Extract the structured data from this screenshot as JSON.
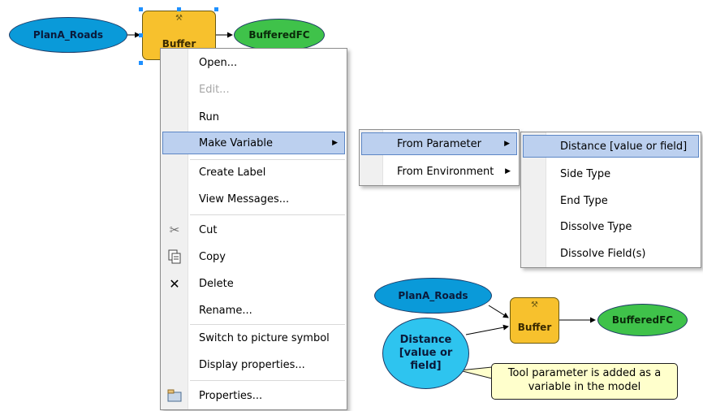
{
  "top_model": {
    "input_label": "PlanA_Roads",
    "tool_label": "Buffer",
    "output_label": "BufferedFC"
  },
  "context_menu": {
    "items": [
      {
        "label": "Open..."
      },
      {
        "label": "Edit..."
      },
      {
        "label": "Run"
      },
      {
        "label": "Make Variable"
      },
      {
        "label": "Create Label"
      },
      {
        "label": "View Messages..."
      },
      {
        "label": "Cut"
      },
      {
        "label": "Copy"
      },
      {
        "label": "Delete"
      },
      {
        "label": "Rename..."
      },
      {
        "label": "Switch to picture symbol"
      },
      {
        "label": "Display properties..."
      },
      {
        "label": "Properties..."
      }
    ]
  },
  "submenu_variable": {
    "items": [
      {
        "label": "From Parameter"
      },
      {
        "label": "From Environment"
      }
    ]
  },
  "submenu_parameter": {
    "items": [
      {
        "label": "Distance [value or field]"
      },
      {
        "label": "Side Type"
      },
      {
        "label": "End Type"
      },
      {
        "label": "Dissolve Type"
      },
      {
        "label": "Dissolve Field(s)"
      }
    ]
  },
  "bottom_model": {
    "input_label": "PlanA_Roads",
    "tool_label": "Buffer",
    "output_label": "BufferedFC",
    "variable_label": "Distance [value or field]"
  },
  "callout": {
    "text": "Tool parameter is added as a variable in the model"
  },
  "colors": {
    "input_fill": "#0a9ad9",
    "tool_fill": "#f7c12d",
    "output_fill": "#3fc24a",
    "variable_fill": "#2ec4ef",
    "highlight": "#bcd0ef",
    "callout_fill": "#ffffcc"
  },
  "icons": [
    "scissors-icon",
    "copy-icon",
    "delete-x-icon",
    "properties-icon",
    "hammer-icon",
    "submenu-arrow-icon"
  ]
}
